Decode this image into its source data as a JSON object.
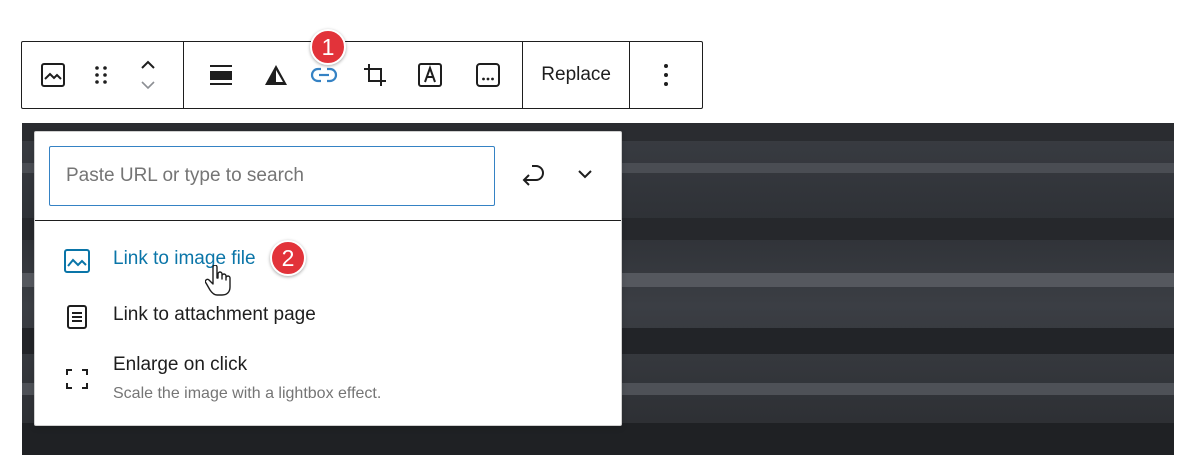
{
  "toolbar": {
    "replace_label": "Replace",
    "icons": [
      "image-icon",
      "drag-handle-icon",
      "chevron-up-icon",
      "chevron-down-icon",
      "align-icon",
      "duotone-icon",
      "link-icon",
      "crop-icon",
      "text-overlay-icon",
      "caption-icon",
      "more-options-icon"
    ],
    "active_color": "#3582c4"
  },
  "callouts": {
    "first": "1",
    "second": "2",
    "color": "#e2333a"
  },
  "link_popover": {
    "search_placeholder": "Paste URL or type to search",
    "options": [
      {
        "label": "Link to image file",
        "icon": "image-icon",
        "description": "",
        "highlighted": true
      },
      {
        "label": "Link to attachment page",
        "icon": "page-icon",
        "description": ""
      },
      {
        "label": "Enlarge on click",
        "icon": "fullscreen-icon",
        "description": "Scale the image with a lightbox effect."
      }
    ],
    "link_color": "#0a75a8"
  }
}
